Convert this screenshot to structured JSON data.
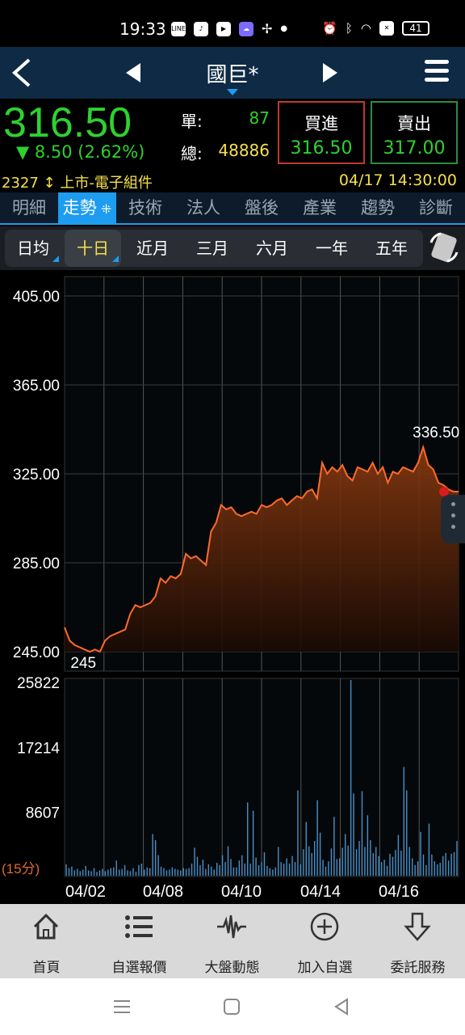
{
  "status": {
    "time": "19:33",
    "battery": "41"
  },
  "nav": {
    "title": "國巨*"
  },
  "quote": {
    "price": "316.50",
    "change": "▼ 8.50 (2.62%)",
    "unit_label": "單:",
    "unit_value": "87",
    "total_label": "總:",
    "total_value": "48886",
    "bid_label": "買進",
    "bid_value": "316.50",
    "ask_label": "賣出",
    "ask_value": "317.00",
    "code": "2327",
    "market": "上市-電子組件",
    "datetime": "04/17 14:30:00"
  },
  "tabs": [
    "明細",
    "走勢",
    "技術",
    "法人",
    "盤後",
    "產業",
    "趨勢",
    "診斷"
  ],
  "active_tab": "走勢",
  "ranges": [
    "日均",
    "十日",
    "近月",
    "三月",
    "六月",
    "一年",
    "五年"
  ],
  "selected_range": "十日",
  "colors": {
    "up": "#2ed12e",
    "accent": "#1e9cf0",
    "line": "#ff6a2a",
    "volume": "#4a90c8",
    "yellow": "#f5e04a"
  },
  "chart_data": [
    {
      "type": "area",
      "y_ticks": [
        "405.00",
        "365.00",
        "325.00",
        "285.00",
        "245.00"
      ],
      "ylim": [
        245,
        405
      ],
      "x_ticks": [
        "04/02",
        "04/08",
        "04/10",
        "04/14",
        "04/16"
      ],
      "annotations": {
        "high": "336.50",
        "low": "245"
      },
      "series": [
        {
          "values": [
            256,
            250,
            248,
            247,
            246,
            245,
            246,
            245,
            250,
            252,
            253,
            254,
            255,
            262,
            266,
            265,
            266,
            267,
            270,
            278,
            276,
            279,
            278,
            280,
            289,
            287,
            288,
            286,
            284,
            299,
            303,
            311,
            309,
            310,
            307,
            306,
            307,
            308,
            307,
            311,
            310,
            311,
            313,
            314,
            311,
            313,
            315,
            314,
            317,
            318,
            314,
            330,
            325,
            328,
            326,
            329,
            324,
            322,
            328,
            327,
            326,
            330,
            325,
            328,
            321,
            326,
            325,
            328,
            327,
            326,
            330,
            337,
            329,
            327,
            321,
            320,
            318,
            317,
            317
          ]
        }
      ]
    },
    {
      "type": "bar",
      "y_ticks": [
        "25822",
        "17214",
        "8607"
      ],
      "ylim": [
        0,
        25822
      ],
      "unit_label": "(15分)",
      "values": [
        1400,
        900,
        1100,
        600,
        800,
        500,
        700,
        1200,
        600,
        500,
        900,
        400,
        600,
        800,
        500,
        700,
        900,
        1000,
        1900,
        700,
        800,
        1300,
        600,
        500,
        900,
        400,
        1300,
        1500,
        700,
        1000,
        900,
        5400,
        4600,
        2600,
        1100,
        900,
        600,
        700,
        1000,
        800,
        700,
        600,
        900,
        800,
        900,
        1500,
        3600,
        2400,
        1300,
        2000,
        800,
        1400,
        1100,
        700,
        1600,
        1300,
        2600,
        1700,
        3800,
        2100,
        1000,
        1000,
        1900,
        2600,
        1500,
        9600,
        1500,
        8500,
        2300,
        1300,
        1700,
        3000,
        1200,
        900,
        700,
        1000,
        3700,
        1700,
        1500,
        2200,
        1500,
        2500,
        1700,
        11200,
        1400,
        3400,
        7000,
        3800,
        2900,
        4500,
        9900,
        5600,
        2000,
        1100,
        1800,
        3500,
        7700,
        2100,
        2200,
        3600,
        5400,
        3900,
        25822,
        10800,
        3400,
        4500,
        11100,
        3700,
        7900,
        4600,
        2900,
        3700,
        2500,
        1700,
        2000,
        1200,
        2800,
        2400,
        3300,
        5300,
        3200,
        14300,
        11200,
        3700,
        2200,
        1300,
        1800,
        5700,
        2700,
        1300,
        6800,
        2700,
        1800,
        1400,
        1600,
        2500,
        2900,
        1900,
        2800,
        3000,
        4500
      ]
    }
  ],
  "bottom_nav": [
    "首頁",
    "自選報價",
    "大盤動態",
    "加入自選",
    "委託服務"
  ]
}
